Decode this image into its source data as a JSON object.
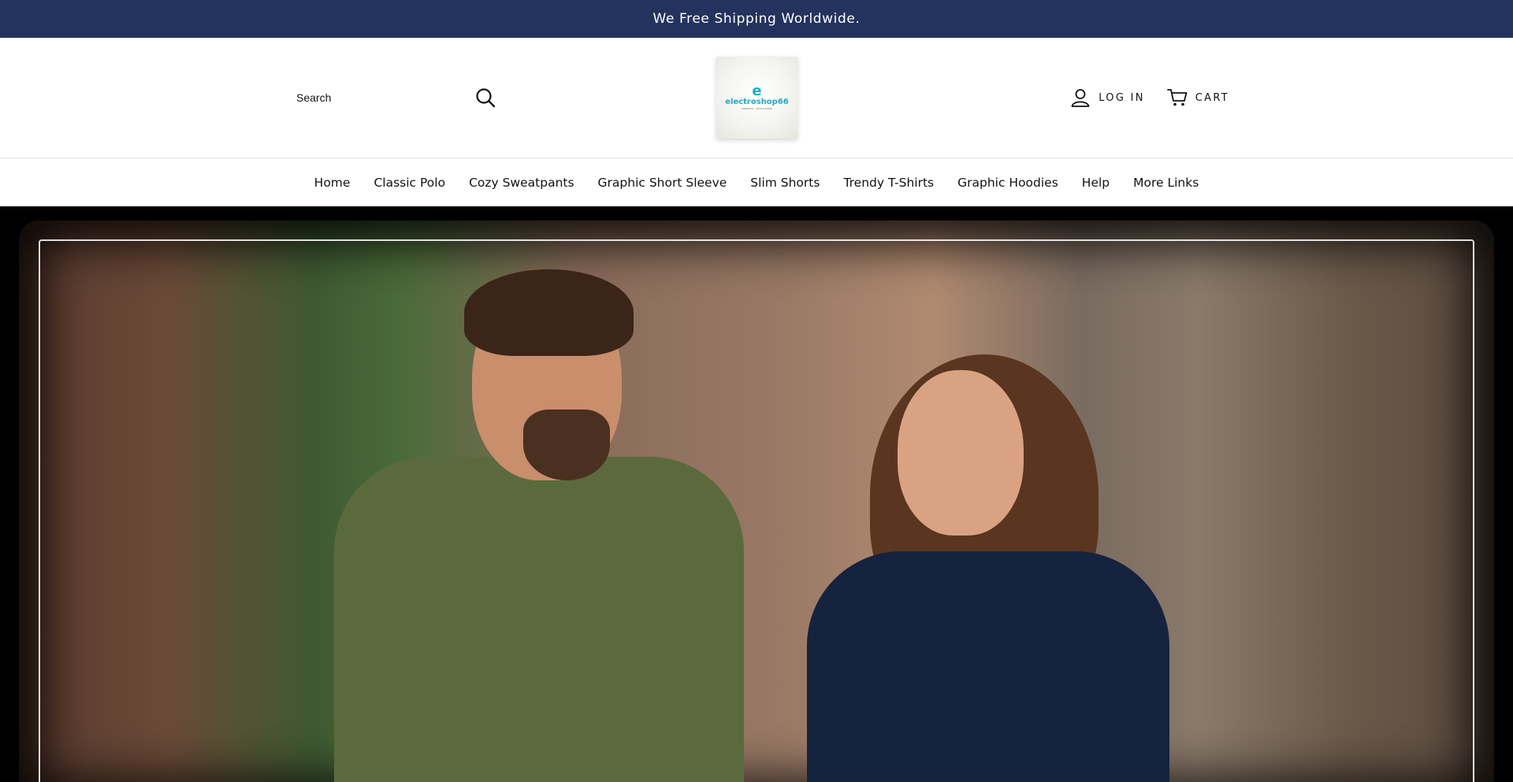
{
  "announcement": {
    "text": "We Free Shipping Worldwide."
  },
  "header": {
    "search": {
      "placeholder": "Search",
      "icon": "search-icon"
    },
    "logo": {
      "primary": "electroshop66",
      "initial": "e",
      "tagline": "WIRELESS · TECH & MORE"
    },
    "account": {
      "label": "LOG IN",
      "icon": "user-icon"
    },
    "cart": {
      "label": "CART",
      "icon": "cart-icon"
    }
  },
  "nav": {
    "items": [
      {
        "label": "Home"
      },
      {
        "label": "Classic Polo"
      },
      {
        "label": "Cozy Sweatpants"
      },
      {
        "label": "Graphic Short Sleeve"
      },
      {
        "label": "Slim Shorts"
      },
      {
        "label": "Trendy T-Shirts"
      },
      {
        "label": "Graphic Hoodies"
      },
      {
        "label": "Help"
      },
      {
        "label": "More Links"
      }
    ]
  },
  "colors": {
    "announcement_bg": "#24335e",
    "logo_accent": "#1fa9c9",
    "text": "#121212"
  }
}
